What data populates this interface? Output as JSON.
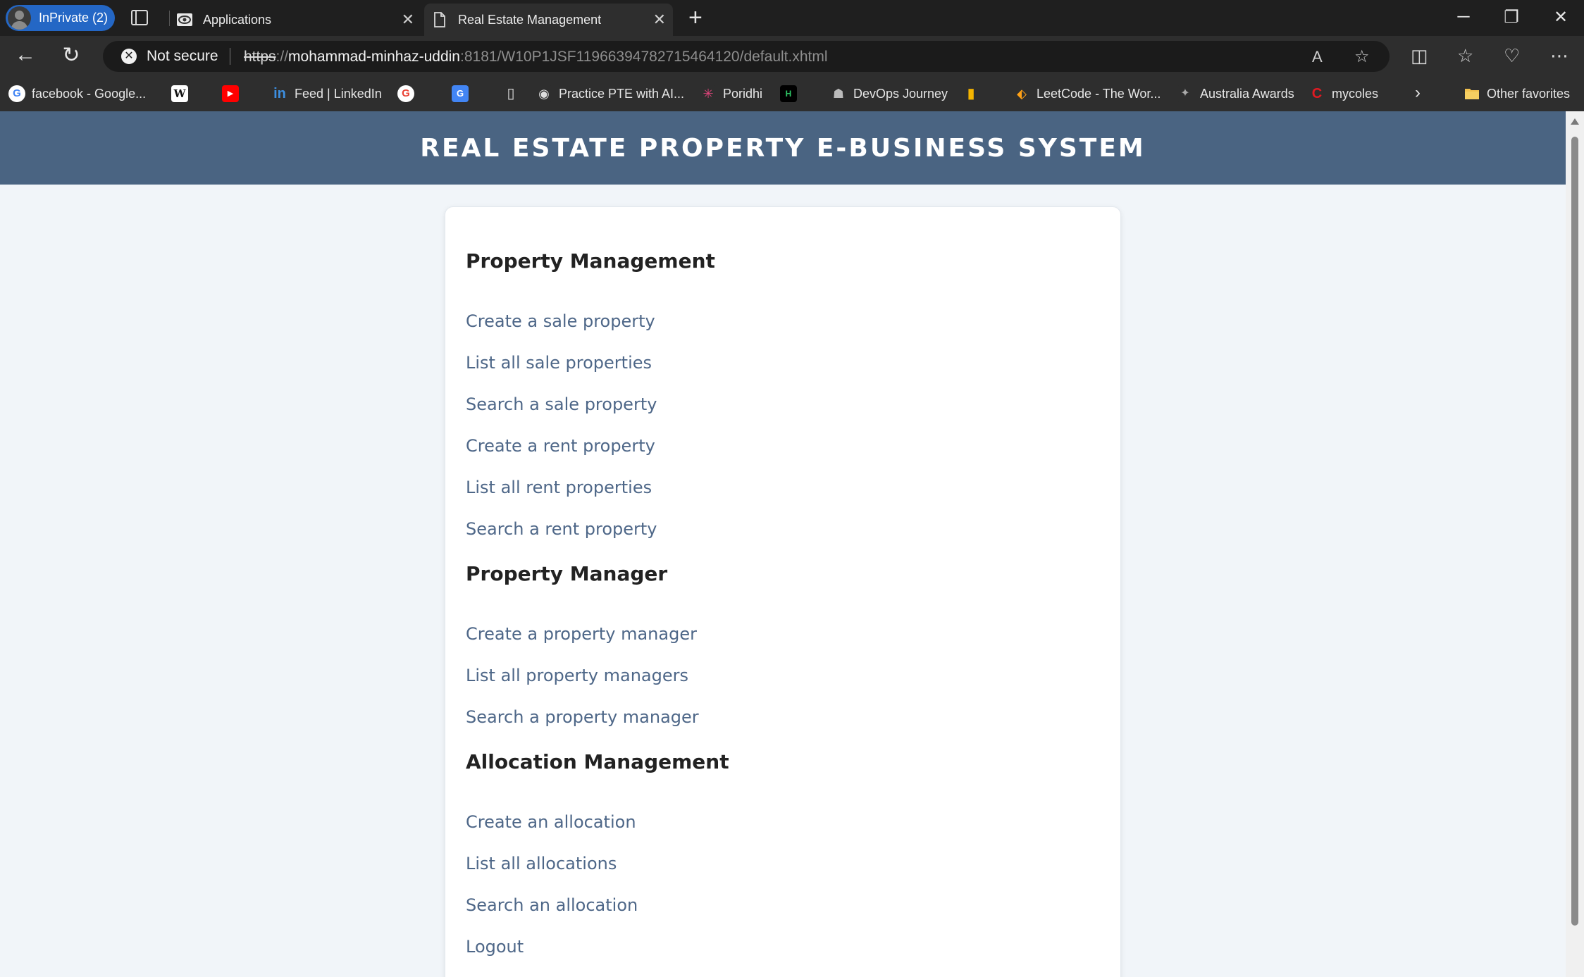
{
  "browser": {
    "inprivate_label": "InPrivate (2)",
    "tabs": [
      {
        "title": "Applications",
        "close": "✕"
      },
      {
        "title": "Real Estate Management",
        "close": "✕"
      }
    ],
    "new_tab": "+",
    "window_controls": {
      "minimize": "─",
      "restore": "❐",
      "close": "✕"
    },
    "nav": {
      "back": "←",
      "refresh": "↻"
    },
    "security": {
      "icon": "✕",
      "label": "Not secure"
    },
    "url": {
      "scheme": "https",
      "separator": "://",
      "host": "mohammad-minhaz-uddin",
      "rest": ":8181/W10P1JSF11966394782715464120/default.xhtml"
    },
    "toolbar_icons": {
      "read_aloud": "A",
      "favorite_star": "☆",
      "split": "◫",
      "favorites": "☆",
      "health": "♡",
      "more": "⋯"
    },
    "bookmarks": [
      {
        "label": "facebook - Google...",
        "icon": "G",
        "color": "#ffffff"
      },
      {
        "label": "",
        "icon": "W",
        "color": "#ffffff"
      },
      {
        "label": "",
        "icon": "▶",
        "color": "#ff0000"
      },
      {
        "label": "Feed | LinkedIn",
        "icon": "in",
        "color": "#0a66c2"
      },
      {
        "label": "",
        "icon": "G",
        "color": "#ffffff"
      },
      {
        "label": "",
        "icon": "G",
        "color": "#4285f4"
      },
      {
        "label": "",
        "icon": "▯",
        "color": "#2e2e2e"
      },
      {
        "label": "Practice PTE with AI...",
        "icon": "◉",
        "color": "#2e2e2e"
      },
      {
        "label": "Poridhi",
        "icon": "✳",
        "color": "#2e2e2e"
      },
      {
        "label": "",
        "icon": "H",
        "color": "#000000"
      },
      {
        "label": "DevOps Journey",
        "icon": "☗",
        "color": "#2e2e2e"
      },
      {
        "label": "",
        "icon": "▮",
        "color": "#2e2e2e"
      },
      {
        "label": "LeetCode - The Wor...",
        "icon": "⬖",
        "color": "#2e2e2e"
      },
      {
        "label": "Australia Awards",
        "icon": "✦",
        "color": "#2e2e2e"
      },
      {
        "label": "mycoles",
        "icon": "C",
        "color": "#2e2e2e"
      }
    ],
    "bookmarks_more": "›",
    "other_favorites": "Other favorites"
  },
  "page": {
    "title": "REAL ESTATE PROPERTY E-BUSINESS SYSTEM",
    "sections": [
      {
        "title": "Property Management",
        "links": [
          "Create a sale property",
          "List all sale properties",
          "Search a sale property",
          "Create a rent property",
          "List all rent properties",
          "Search a rent property"
        ]
      },
      {
        "title": "Property Manager",
        "links": [
          "Create a property manager",
          "List all property managers",
          "Search a property manager"
        ]
      },
      {
        "title": "Allocation Management",
        "links": [
          "Create an allocation",
          "List all allocations",
          "Search an allocation",
          "Logout"
        ]
      }
    ]
  },
  "colors": {
    "header_bg": "#4a6482",
    "page_bg": "#f1f5f9",
    "link": "#4e6788",
    "heading": "#222222"
  }
}
